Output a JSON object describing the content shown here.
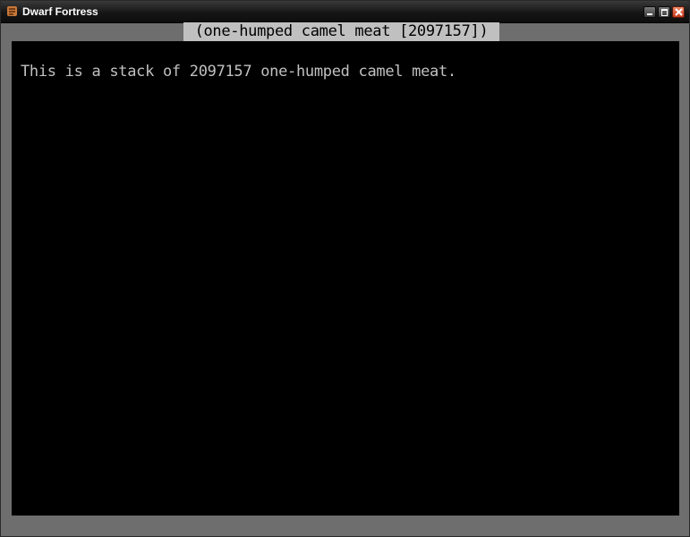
{
  "window": {
    "title": "Dwarf Fortress",
    "icon": "dwarf-fortress-app-icon",
    "controls": [
      "minimize-icon",
      "maximize-icon",
      "close-icon"
    ]
  },
  "screen": {
    "header": "(one-humped camel meat [2097157])",
    "description": "This is a stack of 2097157 one-humped camel meat."
  },
  "colors": {
    "background": "#000000",
    "text": "#c0c0c0",
    "header_bg": "#c0c0c0",
    "frame": "#6e6e6e"
  }
}
